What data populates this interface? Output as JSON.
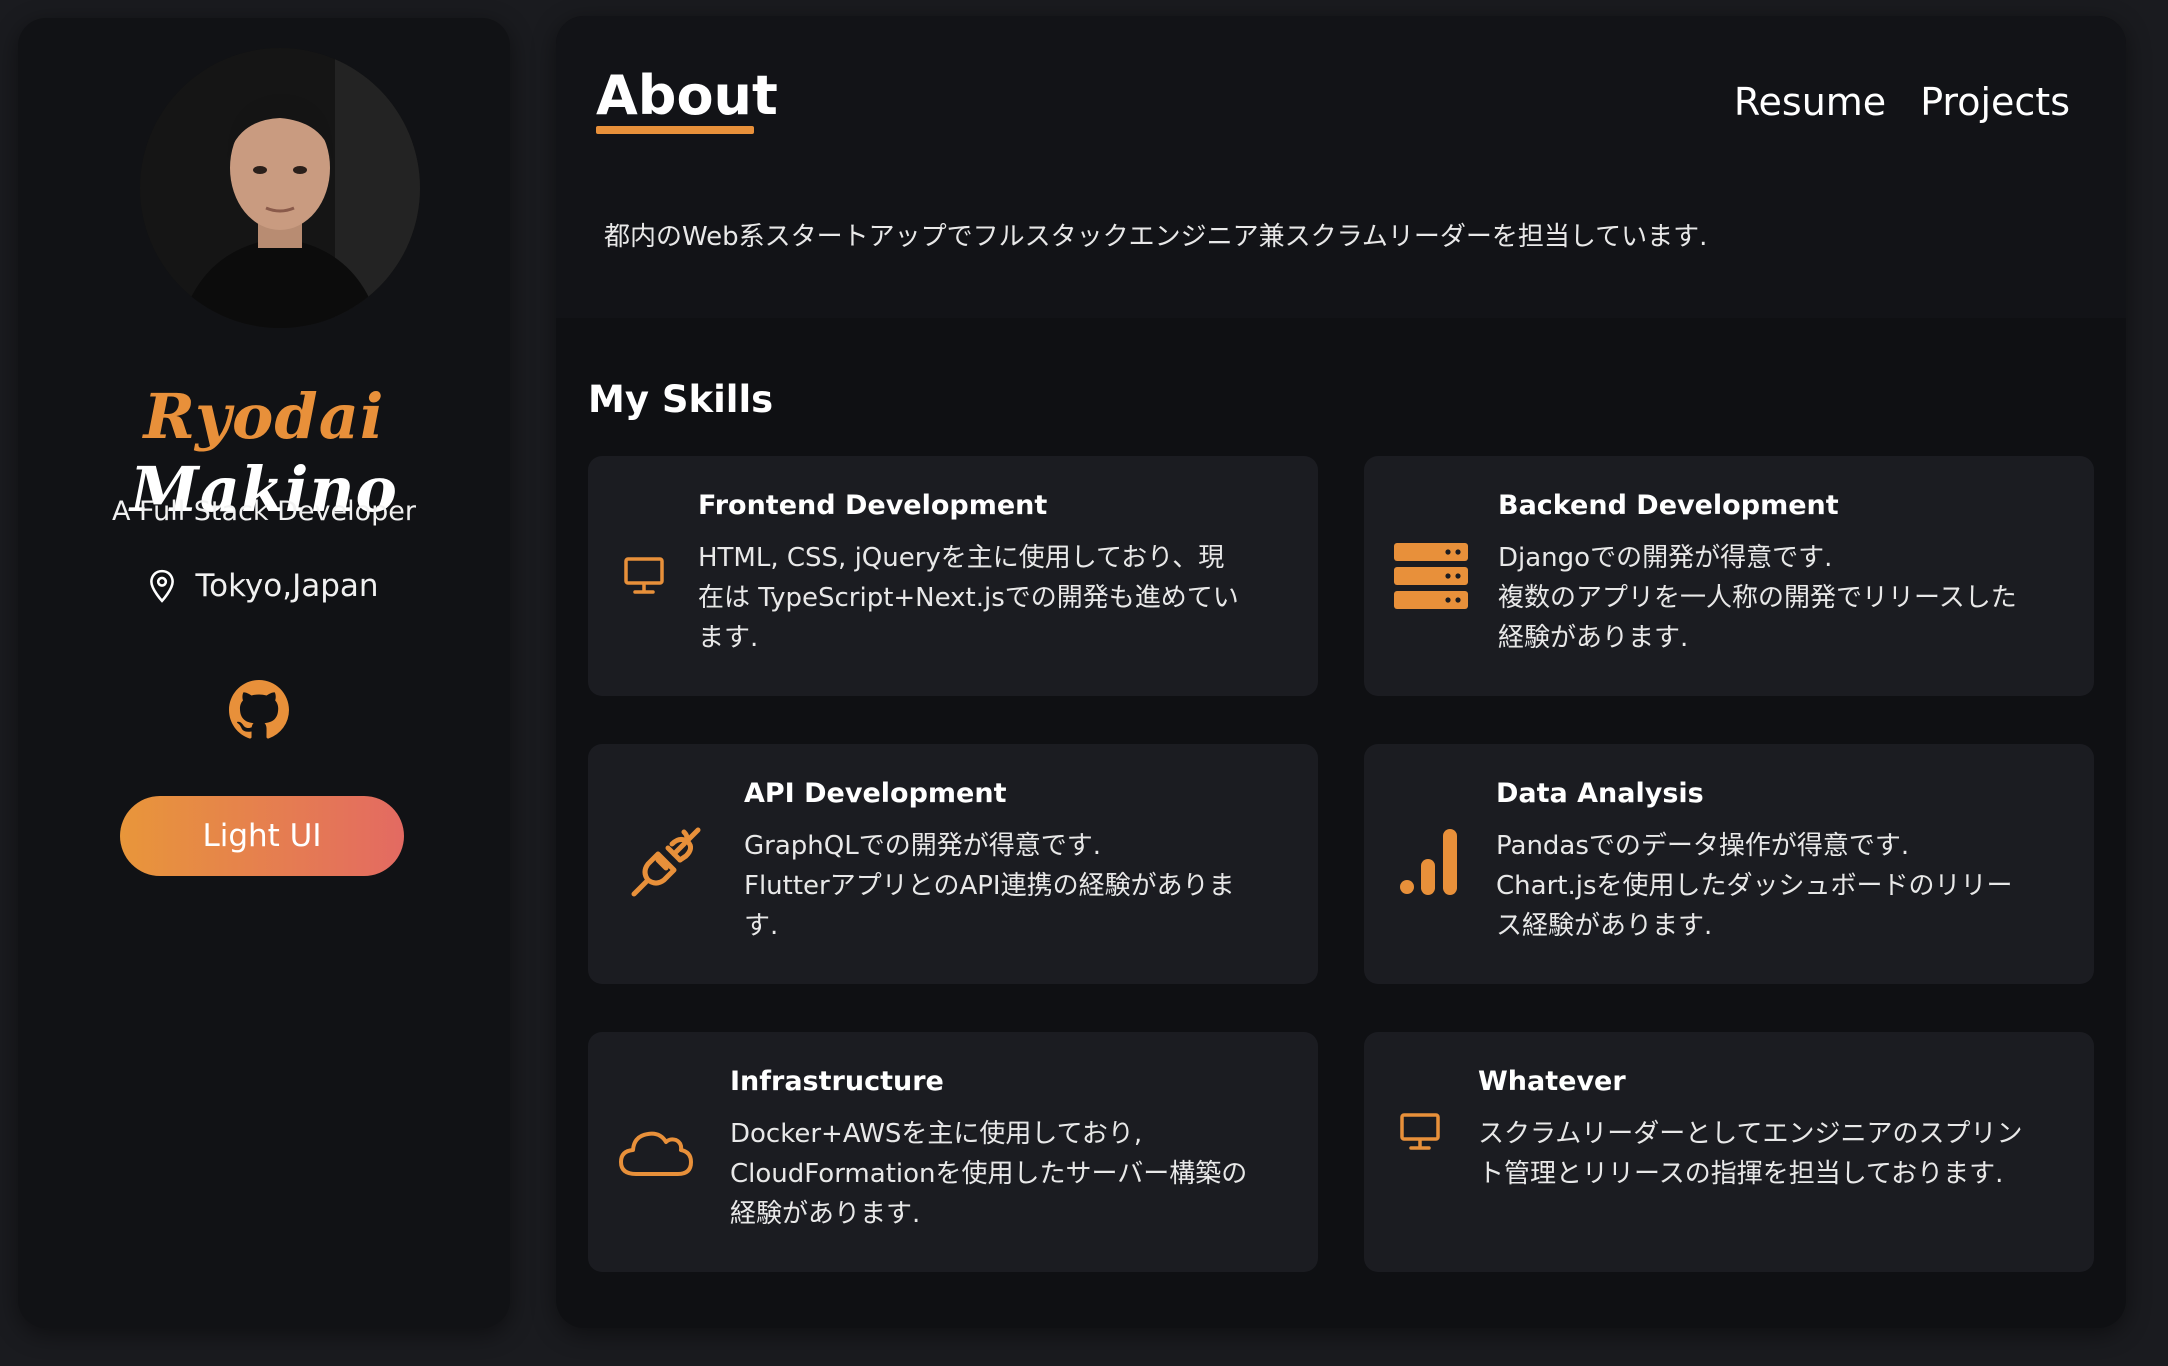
{
  "profile": {
    "first_name": "Ryodai",
    "last_name": "Makino",
    "tagline": "A Full Stack Developer",
    "location": "Tokyo,Japan",
    "theme_button": "Light UI"
  },
  "nav": {
    "active": "About",
    "links": [
      "Resume",
      "Projects"
    ]
  },
  "intro": "都内のWeb系スタートアップでフルスタックエンジニア兼スクラムリーダーを担当しています.",
  "skills_title": "My Skills",
  "skills": [
    {
      "title": "Frontend Development",
      "icon": "monitor-icon",
      "line1": "HTML, CSS, jQueryを主に使用しており、現",
      "line2": "在は TypeScript+Next.jsでの開発も進めてい",
      "line3": "ます."
    },
    {
      "title": "Backend Development",
      "icon": "server-icon",
      "line1": "Djangoでの開発が得意です.",
      "line2": "複数のアプリを一人称の開発でリリースした",
      "line3": "経験があります."
    },
    {
      "title": "API Development",
      "icon": "plug-icon",
      "line1": "GraphQLでの開発が得意です.",
      "line2": "FlutterアプリとのAPI連携の経験がありま",
      "line3": "す."
    },
    {
      "title": "Data Analysis",
      "icon": "bar-chart-icon",
      "line1": "Pandasでのデータ操作が得意です.",
      "line2": "Chart.jsを使用したダッシュボードのリリー",
      "line3": "ス経験があります."
    },
    {
      "title": "Infrastructure",
      "icon": "cloud-icon",
      "line1": "Docker+AWSを主に使用しており,",
      "line2": "CloudFormationを使用したサーバー構築の",
      "line3": "経験があります."
    },
    {
      "title": "Whatever",
      "icon": "monitor-icon",
      "line1": "スクラムリーダーとしてエンジニアのスプリン",
      "line2": "ト管理とリリースの指揮を担当しております.",
      "line3": ""
    }
  ],
  "colors": {
    "accent": "#e8903a",
    "button_gradient_end": "#e36a62",
    "card_bg": "#1b1c21"
  }
}
